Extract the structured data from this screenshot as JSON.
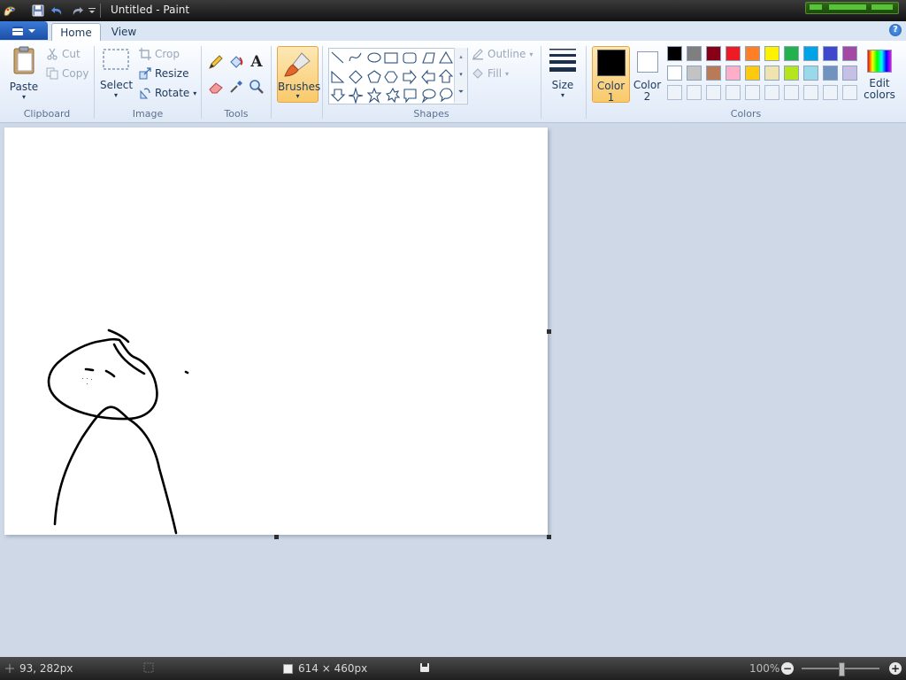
{
  "window": {
    "title": "Untitled - Paint"
  },
  "tabs": [
    {
      "label": "Home",
      "active": true
    },
    {
      "label": "View",
      "active": false
    }
  ],
  "ribbon": {
    "clipboard": {
      "label": "Clipboard",
      "paste": "Paste",
      "cut": "Cut",
      "copy": "Copy"
    },
    "image": {
      "label": "Image",
      "select": "Select",
      "crop": "Crop",
      "resize": "Resize",
      "rotate": "Rotate"
    },
    "tools": {
      "label": "Tools"
    },
    "brushes": {
      "label": "Brushes"
    },
    "shapes": {
      "label": "Shapes",
      "outline": "Outline",
      "fill": "Fill"
    },
    "size": {
      "label": "Size"
    },
    "colors": {
      "label": "Colors",
      "color1_line1": "Color",
      "color1_line2": "1",
      "color2_line1": "Color",
      "color2_line2": "2",
      "edit_line1": "Edit",
      "edit_line2": "colors",
      "color1_value": "#000000",
      "color2_value": "#ffffff",
      "palette_row1": [
        "#000000",
        "#7f7f7f",
        "#880015",
        "#ed1c24",
        "#ff7f27",
        "#fff200",
        "#22b14c",
        "#00a2e8",
        "#3f48cc",
        "#a349a4"
      ],
      "palette_row2": [
        "#ffffff",
        "#c3c3c3",
        "#b97a57",
        "#ffaec9",
        "#ffc90e",
        "#efe4b0",
        "#b5e61d",
        "#99d9ea",
        "#7092be",
        "#c8bfe7"
      ]
    }
  },
  "status": {
    "cursor_pos": "93, 282px",
    "canvas_size": "614 × 460px",
    "zoom": "100%"
  }
}
